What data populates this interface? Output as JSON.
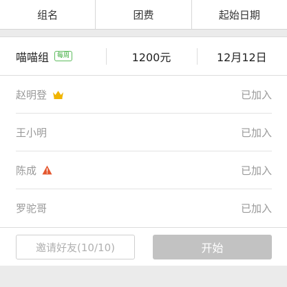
{
  "header": {
    "col_name": "组名",
    "col_fee": "团费",
    "col_date": "起始日期"
  },
  "group": {
    "name": "喵喵组",
    "badge": "每周",
    "fee": "1200元",
    "date": "12月12日"
  },
  "members": [
    {
      "name": "赵明登",
      "icon": "crown-icon",
      "status": "已加入"
    },
    {
      "name": "王小明",
      "icon": "",
      "status": "已加入"
    },
    {
      "name": "陈成",
      "icon": "warning-icon",
      "status": "已加入"
    },
    {
      "name": "罗驼哥",
      "icon": "",
      "status": "已加入"
    }
  ],
  "actions": {
    "invite_label": "邀请好友(10/10)",
    "start_label": "开始"
  },
  "colors": {
    "badge_green": "#3aaa3a",
    "crown_gold": "#f0b400",
    "warning_red": "#e4572e",
    "start_disabled": "#c2c2c2"
  }
}
